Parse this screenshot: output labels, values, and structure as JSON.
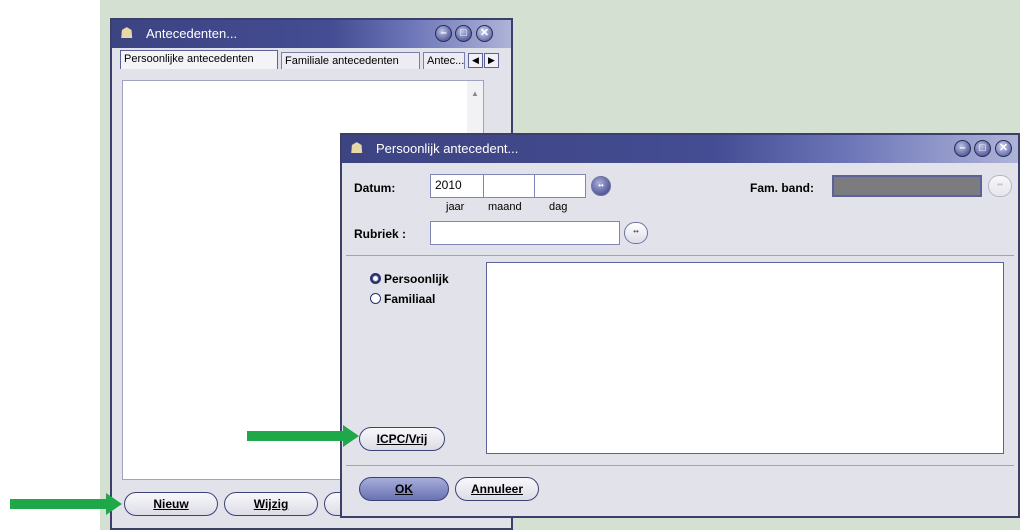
{
  "back_window": {
    "title": "Antecedenten...",
    "tabs": [
      "Persoonlijke antecedenten",
      "Familiale antecedenten",
      "Antec..."
    ],
    "buttons": {
      "new": "Nieuw",
      "edit": "Wijzig"
    }
  },
  "dialog": {
    "title": "Persoonlijk antecedent...",
    "datum_label": "Datum:",
    "year_value": "2010",
    "month_value": "",
    "day_value": "",
    "sub_jaar": "jaar",
    "sub_maand": "maand",
    "sub_dag": "dag",
    "fam_band_label": "Fam. band:",
    "rubriek_label": "Rubriek :",
    "rubriek_value": "",
    "radio_persoonlijk": "Persoonlijk",
    "radio_familiaal": "Familiaal",
    "radio_selected": "Persoonlijk",
    "icpc_button": "ICPC/Vrij",
    "ok_button": "OK",
    "cancel_button": "Annuleer"
  },
  "icons": {
    "app_icon": "user-icon",
    "minimize": "minimize-icon",
    "maximize": "maximize-icon",
    "close": "close-icon",
    "lookup": "ellipsis-icon",
    "arrow": "green-arrow-icon"
  },
  "colors": {
    "titlebar": "#444c93",
    "desktop": "#d4e0d2",
    "arrow": "#1fa84a",
    "fam_band_field": "#7c7c80"
  }
}
